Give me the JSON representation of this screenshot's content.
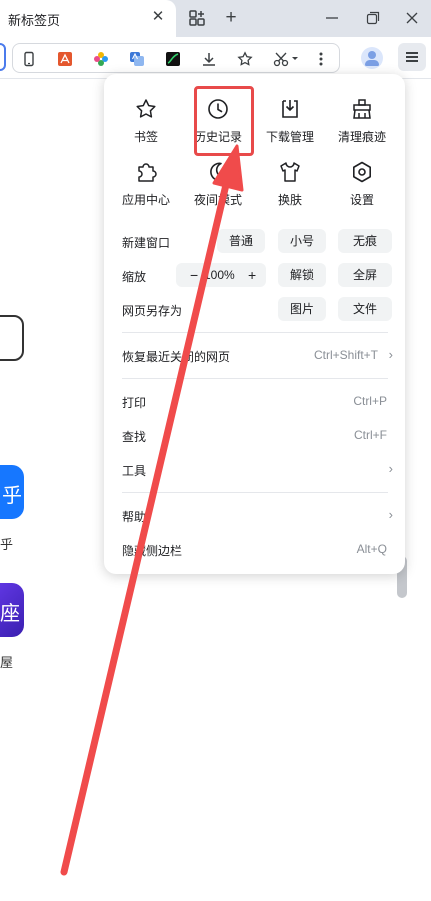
{
  "tab": {
    "title": "新标签页",
    "close": "✕"
  },
  "tabstrip": {
    "new_tab": "+"
  },
  "menu": {
    "quick_actions": [
      {
        "label": "书签",
        "icon": "star-icon"
      },
      {
        "label": "历史记录",
        "icon": "clock-icon"
      },
      {
        "label": "下载管理",
        "icon": "download-icon"
      },
      {
        "label": "清理痕迹",
        "icon": "broom-icon"
      },
      {
        "label": "应用中心",
        "icon": "puzzle-icon"
      },
      {
        "label": "夜间模式",
        "icon": "moon-icon"
      },
      {
        "label": "换肤",
        "icon": "shirt-icon"
      },
      {
        "label": "设置",
        "icon": "hexagon-gear-icon"
      }
    ],
    "new_window": {
      "label": "新建窗口",
      "normal": "普通",
      "small": "小号",
      "incognito": "无痕"
    },
    "zoom": {
      "label": "缩放",
      "minus": "−",
      "value": "100%",
      "plus": "+",
      "unlock": "解锁",
      "fullscreen": "全屏"
    },
    "save_as": {
      "label": "网页另存为",
      "image": "图片",
      "file": "文件"
    },
    "restore": {
      "label": "恢复最近关闭的网页",
      "shortcut": "Ctrl+Shift+T"
    },
    "print": {
      "label": "打印",
      "shortcut": "Ctrl+P"
    },
    "find": {
      "label": "查找",
      "shortcut": "Ctrl+F"
    },
    "tools": {
      "label": "工具"
    },
    "help": {
      "label": "帮助"
    },
    "hide_sidebar": {
      "label": "隐藏侧边栏",
      "shortcut": "Alt+Q"
    }
  },
  "background": {
    "app1_glyph": "乎",
    "app1_label": "乎",
    "app2_glyph": "座",
    "app2_label": "屋"
  },
  "colors": {
    "highlight": "#e84a4a",
    "arrow": "#f04b4b",
    "accent": "#4b7bec"
  }
}
